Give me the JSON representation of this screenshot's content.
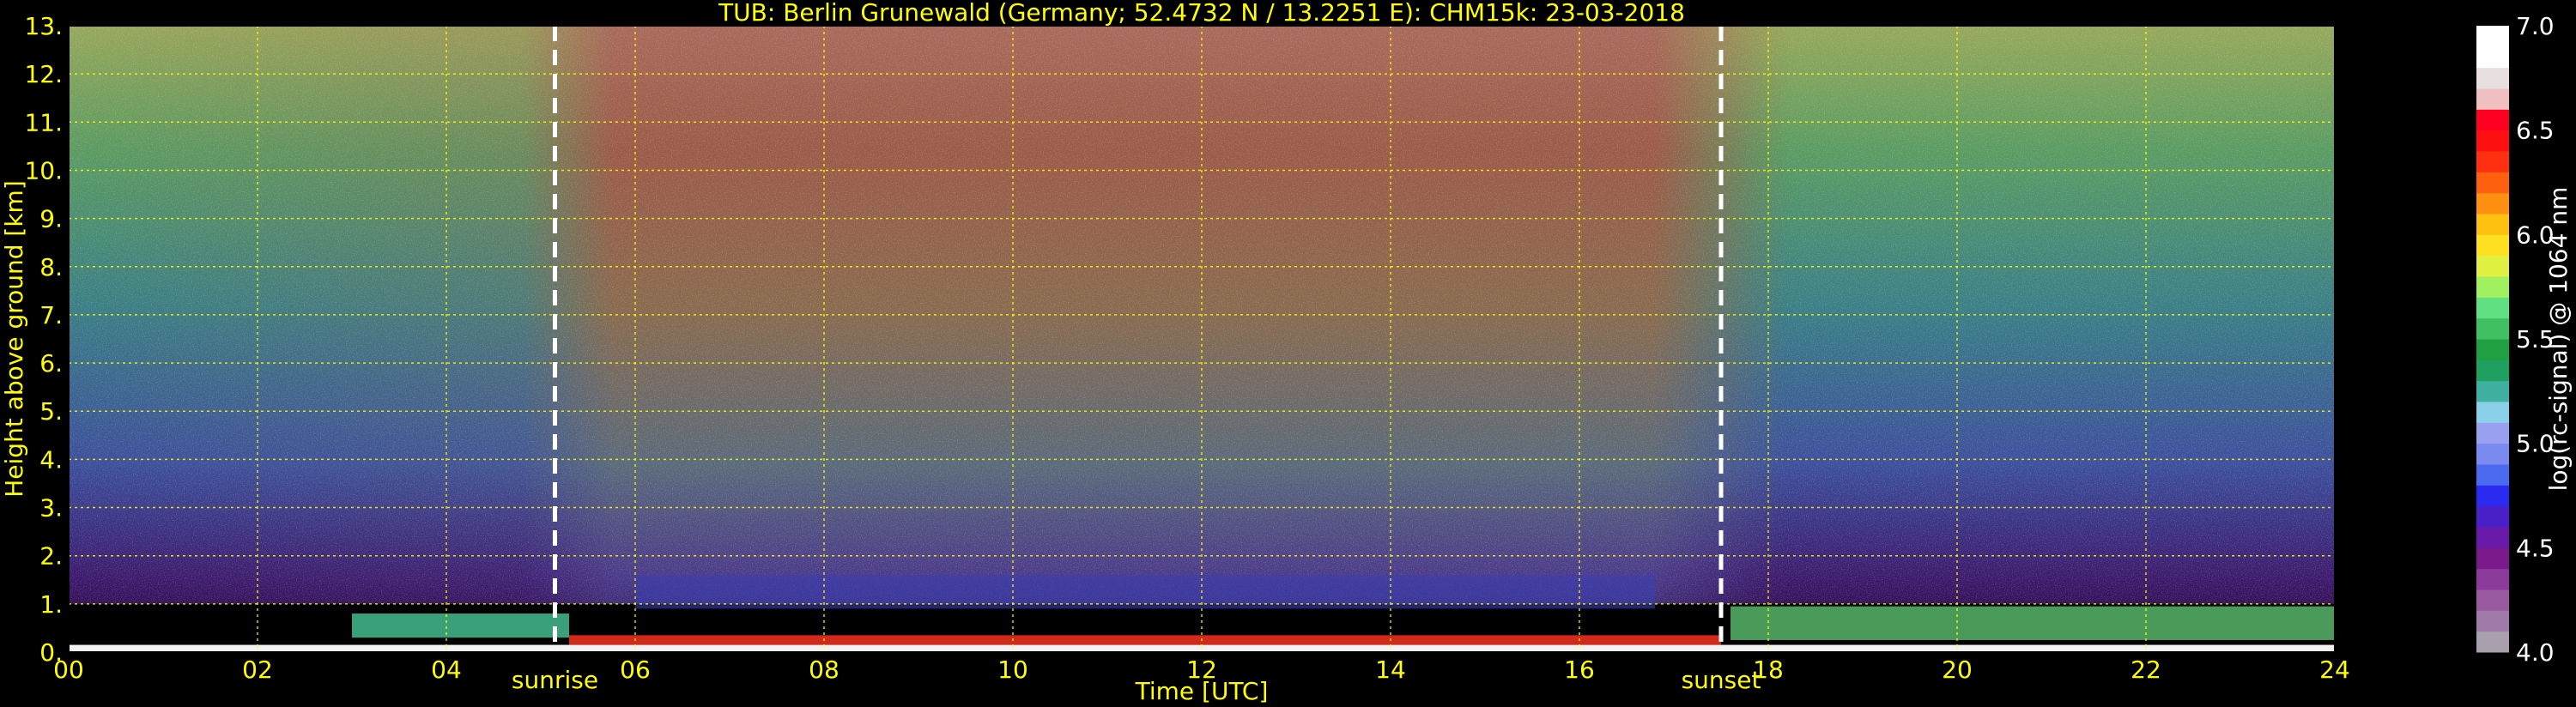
{
  "chart_data": {
    "type": "heatmap",
    "title": "TUB: Berlin Grunewald (Germany; 52.4732 N / 13.2251 E):    CHM15k: 23-03-2018",
    "xlabel": "Time [UTC]",
    "ylabel": "Height above ground [km]",
    "xlim": [
      0,
      24
    ],
    "ylim": [
      0,
      13
    ],
    "x_ticks": [
      "00",
      "02",
      "04",
      "06",
      "08",
      "10",
      "12",
      "14",
      "16",
      "18",
      "20",
      "22",
      "24"
    ],
    "y_ticks": [
      "0.",
      "1.",
      "2.",
      "3.",
      "4.",
      "5.",
      "6.",
      "7.",
      "8.",
      "9.",
      "10.",
      "11.",
      "12.",
      "13."
    ],
    "grid": true,
    "annotations": [
      {
        "label": "sunrise",
        "time_h": 5.15
      },
      {
        "label": "sunset",
        "time_h": 17.5
      }
    ],
    "colorbar": {
      "label": "log(rc-signal) @ 1064 nm",
      "range": [
        4.0,
        7.0
      ],
      "ticks": [
        "4.0",
        "4.5",
        "5.0",
        "5.5",
        "6.0",
        "6.5",
        "7.0"
      ]
    },
    "colors": {
      "background": "#000000",
      "text": "#ffff00",
      "grid": "#ffff00",
      "marker_line": "#ffffff"
    }
  }
}
